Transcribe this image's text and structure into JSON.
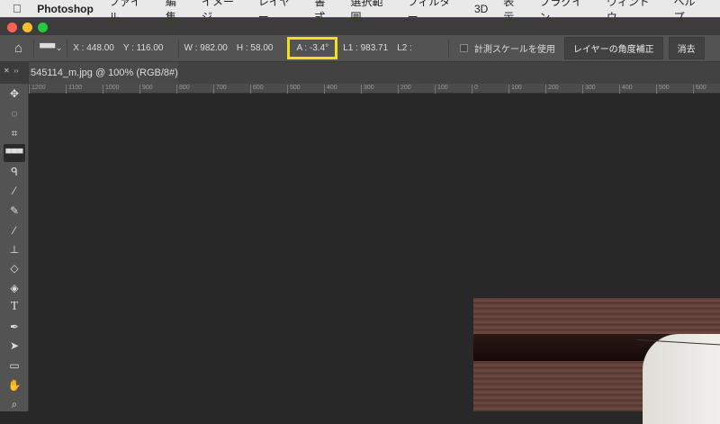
{
  "menubar": {
    "app": "Photoshop",
    "items": [
      "ファイル",
      "編集",
      "イメージ",
      "レイヤー",
      "書式",
      "選択範囲",
      "フィルター",
      "3D",
      "表示",
      "プラグイン",
      "ウィンドウ",
      "ヘルプ"
    ]
  },
  "options": {
    "x": "X : 448.00",
    "y": "Y : 116.00",
    "w": "W : 982.00",
    "h": "H : 58.00",
    "a": "A : -3.4°",
    "l1": "L1 : 983.71",
    "l2": "L2 :",
    "scale_label": "計測スケールを使用",
    "straighten": "レイヤーの角度補正",
    "clear": "消去"
  },
  "document": {
    "tab": "545114_m.jpg @ 100% (RGB/8#)"
  },
  "ruler": [
    "1200",
    "1100",
    "1000",
    "900",
    "800",
    "700",
    "600",
    "500",
    "400",
    "300",
    "200",
    "100",
    "0",
    "100",
    "200",
    "300",
    "400",
    "500",
    "600"
  ],
  "tools": [
    "move",
    "marquee",
    "crop",
    "ruler",
    "lasso",
    "magic-wand",
    "eyedropper",
    "brush",
    "clone-stamp",
    "eraser",
    "paint-bucket",
    "type",
    "pen",
    "path-select",
    "rectangle",
    "hand",
    "zoom"
  ],
  "colors": {
    "highlight": "#f0e21a"
  }
}
